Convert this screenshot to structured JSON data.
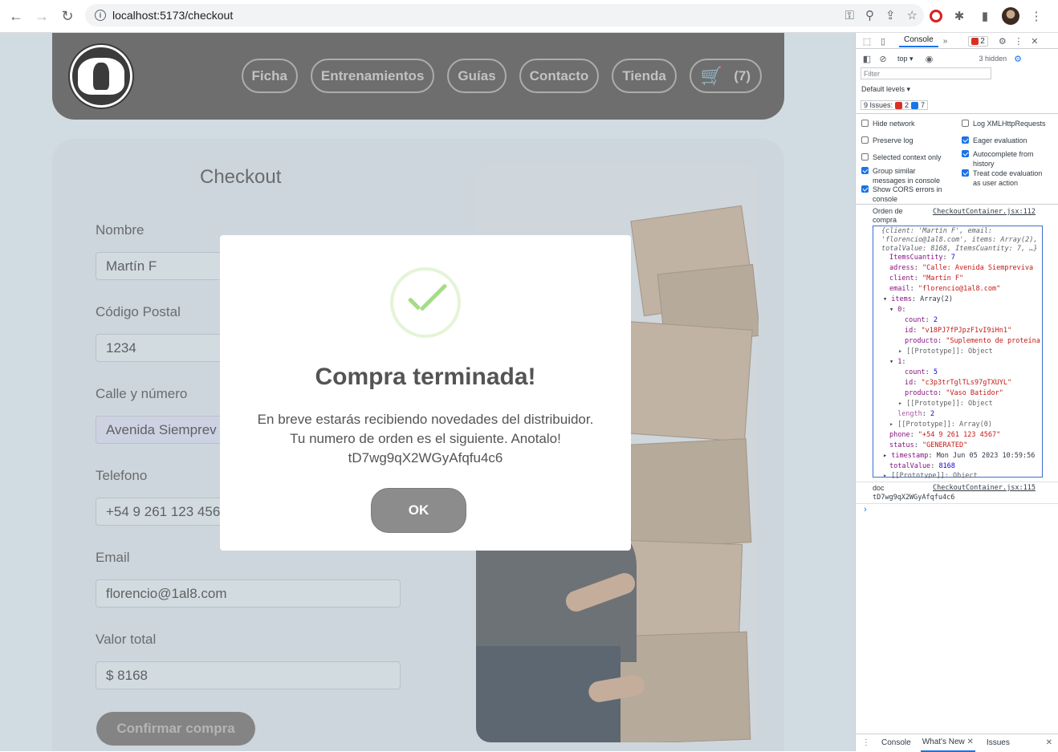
{
  "browser": {
    "url": "localhost:5173/checkout"
  },
  "navbar": {
    "links": [
      "Ficha",
      "Entrenamientos",
      "Guías",
      "Contacto",
      "Tienda"
    ],
    "cart_count": "(7)"
  },
  "form": {
    "title": "Checkout",
    "fields": [
      {
        "label": "Nombre",
        "value": "Martín F"
      },
      {
        "label": "Código Postal",
        "value": "1234"
      },
      {
        "label": "Calle y número",
        "value": "Avenida Siemprev"
      },
      {
        "label": "Telefono",
        "value": "+54 9 261 123 4567"
      },
      {
        "label": "Email",
        "value": "florencio@1al8.com"
      },
      {
        "label": "Valor total",
        "value": "$ 8168"
      }
    ],
    "confirm_label": "Confirmar compra"
  },
  "modal": {
    "title": "Compra terminada!",
    "line1": "En breve estarás recibiendo novedades del distribuidor.",
    "line2": "Tu numero de orden es el siguiente. Anotalo!",
    "order_id": "tD7wg9qX2WGyAfqfu4c6",
    "ok_label": "OK"
  },
  "devtools": {
    "tab_console": "Console",
    "more": "»",
    "error_count": "2",
    "context": "top",
    "hidden": "3 hidden",
    "filter_placeholder": "Filter",
    "levels": "Default levels",
    "issues_label": "9 Issues:",
    "issues_err": "2",
    "issues_info": "7",
    "options": [
      {
        "label": "Hide network",
        "checked": false
      },
      {
        "label": "Log XMLHttpRequests",
        "checked": false
      },
      {
        "label": "Preserve log",
        "checked": false
      },
      {
        "label": "Eager evaluation",
        "checked": true
      },
      {
        "label": "Selected context only",
        "checked": false
      },
      {
        "label": "Autocomplete from history",
        "checked": true
      },
      {
        "label": "Group similar messages in console",
        "checked": true
      },
      {
        "label": "Treat code evaluation as user action",
        "checked": true
      },
      {
        "label": "Show CORS errors in console",
        "checked": true
      }
    ],
    "log1_label": "Orden de compra",
    "log1_source": "CheckoutContainer.jsx:112",
    "obj_summary": "{client: 'Martín F', email: 'florencio@1al8.com', items: Array(2), totalValue: 8168, ItemsCuantity: 7, …}",
    "props": {
      "ItemsCuantity": "7",
      "adress": "\"Calle: Avenida Siempreviva",
      "client": "\"Martín F\"",
      "email": "\"florencio@1al8.com\"",
      "items": "Array(2)",
      "item0_count": "2",
      "item0_id": "\"v18PJ7fPJpzF1vI9iHn1\"",
      "item0_producto": "\"Suplemento de proteína",
      "item1_count": "5",
      "item1_id": "\"c3p3trTglTLs97gTXUYL\"",
      "item1_producto": "\"Vaso Batidor\"",
      "length": "2",
      "phone": "\"+54 9 261 123 4567\"",
      "status": "\"GENERATED\"",
      "timestamp": "Mon Jun 05 2023 10:59:56",
      "totalValue": "8168"
    },
    "proto_object": "[[Prototype]]: Object",
    "proto_array": "[[Prototype]]: Array(0)",
    "log2_label": "doc",
    "log2_source": "CheckoutContainer.jsx:115",
    "log2_value": "tD7wg9qX2WGyAfqfu4c6",
    "bottom_tabs": [
      "Console",
      "What's New",
      "Issues"
    ]
  }
}
